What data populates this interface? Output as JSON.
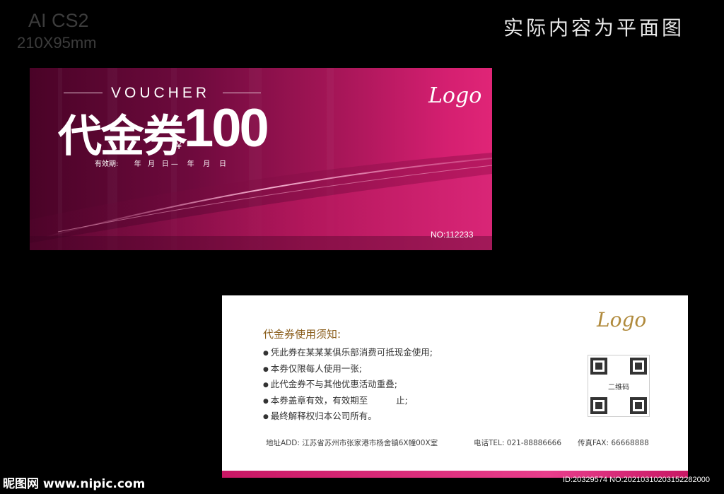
{
  "spec": {
    "format": "AI CS2",
    "size": "210X95mm"
  },
  "note": "实际内容为平面图",
  "front": {
    "voucher_word": "VOUCHER",
    "title_cn": "代金券",
    "currency": "¥",
    "amount": "100",
    "validity": "有效期:       年   月   日 —    年    月    日",
    "logo": "Logo",
    "serial": "NO:112233",
    "colors": {
      "dark": "#4a0327",
      "accent": "#e02577"
    }
  },
  "back": {
    "logo": "Logo",
    "rules_title": "代金券使用须知:",
    "rules": [
      "凭此券在某某某俱乐部消费可抵现金使用;",
      "本券仅限每人使用一张;",
      "此代金券不与其他优惠活动重叠;",
      "本券盖章有效，有效期至          止;",
      "最终解释权归本公司所有。"
    ],
    "qr_label": "二维码",
    "address": "地址ADD: 江苏省苏州市张家港市杨舍镇6X幢00X室",
    "tel": "电话TEL: 021-88886666",
    "fax": "传真FAX: 66668888"
  },
  "watermark": {
    "site": "昵图网 www.nipic.com",
    "id": "ID:20329574 NO:20210310203152282000"
  }
}
